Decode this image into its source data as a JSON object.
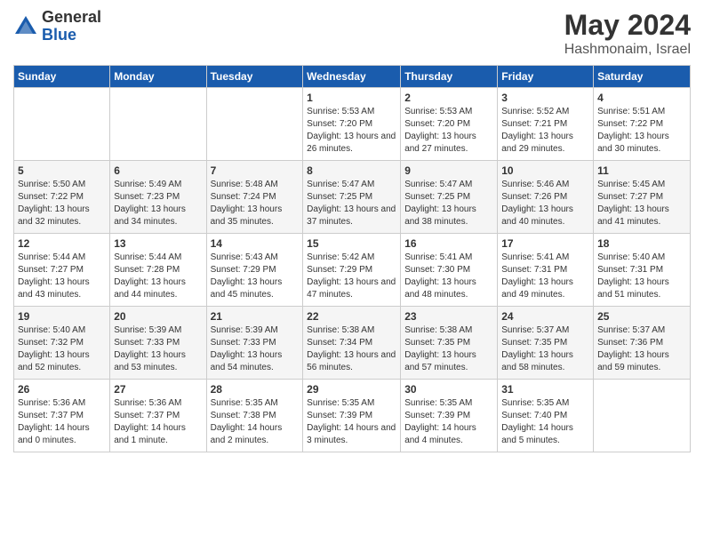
{
  "logo": {
    "general": "General",
    "blue": "Blue"
  },
  "title": "May 2024",
  "location": "Hashmonaim, Israel",
  "headers": [
    "Sunday",
    "Monday",
    "Tuesday",
    "Wednesday",
    "Thursday",
    "Friday",
    "Saturday"
  ],
  "weeks": [
    [
      {
        "day": "",
        "sunrise": "",
        "sunset": "",
        "daylight": ""
      },
      {
        "day": "",
        "sunrise": "",
        "sunset": "",
        "daylight": ""
      },
      {
        "day": "",
        "sunrise": "",
        "sunset": "",
        "daylight": ""
      },
      {
        "day": "1",
        "sunrise": "Sunrise: 5:53 AM",
        "sunset": "Sunset: 7:20 PM",
        "daylight": "Daylight: 13 hours and 26 minutes."
      },
      {
        "day": "2",
        "sunrise": "Sunrise: 5:53 AM",
        "sunset": "Sunset: 7:20 PM",
        "daylight": "Daylight: 13 hours and 27 minutes."
      },
      {
        "day": "3",
        "sunrise": "Sunrise: 5:52 AM",
        "sunset": "Sunset: 7:21 PM",
        "daylight": "Daylight: 13 hours and 29 minutes."
      },
      {
        "day": "4",
        "sunrise": "Sunrise: 5:51 AM",
        "sunset": "Sunset: 7:22 PM",
        "daylight": "Daylight: 13 hours and 30 minutes."
      }
    ],
    [
      {
        "day": "5",
        "sunrise": "Sunrise: 5:50 AM",
        "sunset": "Sunset: 7:22 PM",
        "daylight": "Daylight: 13 hours and 32 minutes."
      },
      {
        "day": "6",
        "sunrise": "Sunrise: 5:49 AM",
        "sunset": "Sunset: 7:23 PM",
        "daylight": "Daylight: 13 hours and 34 minutes."
      },
      {
        "day": "7",
        "sunrise": "Sunrise: 5:48 AM",
        "sunset": "Sunset: 7:24 PM",
        "daylight": "Daylight: 13 hours and 35 minutes."
      },
      {
        "day": "8",
        "sunrise": "Sunrise: 5:47 AM",
        "sunset": "Sunset: 7:25 PM",
        "daylight": "Daylight: 13 hours and 37 minutes."
      },
      {
        "day": "9",
        "sunrise": "Sunrise: 5:47 AM",
        "sunset": "Sunset: 7:25 PM",
        "daylight": "Daylight: 13 hours and 38 minutes."
      },
      {
        "day": "10",
        "sunrise": "Sunrise: 5:46 AM",
        "sunset": "Sunset: 7:26 PM",
        "daylight": "Daylight: 13 hours and 40 minutes."
      },
      {
        "day": "11",
        "sunrise": "Sunrise: 5:45 AM",
        "sunset": "Sunset: 7:27 PM",
        "daylight": "Daylight: 13 hours and 41 minutes."
      }
    ],
    [
      {
        "day": "12",
        "sunrise": "Sunrise: 5:44 AM",
        "sunset": "Sunset: 7:27 PM",
        "daylight": "Daylight: 13 hours and 43 minutes."
      },
      {
        "day": "13",
        "sunrise": "Sunrise: 5:44 AM",
        "sunset": "Sunset: 7:28 PM",
        "daylight": "Daylight: 13 hours and 44 minutes."
      },
      {
        "day": "14",
        "sunrise": "Sunrise: 5:43 AM",
        "sunset": "Sunset: 7:29 PM",
        "daylight": "Daylight: 13 hours and 45 minutes."
      },
      {
        "day": "15",
        "sunrise": "Sunrise: 5:42 AM",
        "sunset": "Sunset: 7:29 PM",
        "daylight": "Daylight: 13 hours and 47 minutes."
      },
      {
        "day": "16",
        "sunrise": "Sunrise: 5:41 AM",
        "sunset": "Sunset: 7:30 PM",
        "daylight": "Daylight: 13 hours and 48 minutes."
      },
      {
        "day": "17",
        "sunrise": "Sunrise: 5:41 AM",
        "sunset": "Sunset: 7:31 PM",
        "daylight": "Daylight: 13 hours and 49 minutes."
      },
      {
        "day": "18",
        "sunrise": "Sunrise: 5:40 AM",
        "sunset": "Sunset: 7:31 PM",
        "daylight": "Daylight: 13 hours and 51 minutes."
      }
    ],
    [
      {
        "day": "19",
        "sunrise": "Sunrise: 5:40 AM",
        "sunset": "Sunset: 7:32 PM",
        "daylight": "Daylight: 13 hours and 52 minutes."
      },
      {
        "day": "20",
        "sunrise": "Sunrise: 5:39 AM",
        "sunset": "Sunset: 7:33 PM",
        "daylight": "Daylight: 13 hours and 53 minutes."
      },
      {
        "day": "21",
        "sunrise": "Sunrise: 5:39 AM",
        "sunset": "Sunset: 7:33 PM",
        "daylight": "Daylight: 13 hours and 54 minutes."
      },
      {
        "day": "22",
        "sunrise": "Sunrise: 5:38 AM",
        "sunset": "Sunset: 7:34 PM",
        "daylight": "Daylight: 13 hours and 56 minutes."
      },
      {
        "day": "23",
        "sunrise": "Sunrise: 5:38 AM",
        "sunset": "Sunset: 7:35 PM",
        "daylight": "Daylight: 13 hours and 57 minutes."
      },
      {
        "day": "24",
        "sunrise": "Sunrise: 5:37 AM",
        "sunset": "Sunset: 7:35 PM",
        "daylight": "Daylight: 13 hours and 58 minutes."
      },
      {
        "day": "25",
        "sunrise": "Sunrise: 5:37 AM",
        "sunset": "Sunset: 7:36 PM",
        "daylight": "Daylight: 13 hours and 59 minutes."
      }
    ],
    [
      {
        "day": "26",
        "sunrise": "Sunrise: 5:36 AM",
        "sunset": "Sunset: 7:37 PM",
        "daylight": "Daylight: 14 hours and 0 minutes."
      },
      {
        "day": "27",
        "sunrise": "Sunrise: 5:36 AM",
        "sunset": "Sunset: 7:37 PM",
        "daylight": "Daylight: 14 hours and 1 minute."
      },
      {
        "day": "28",
        "sunrise": "Sunrise: 5:35 AM",
        "sunset": "Sunset: 7:38 PM",
        "daylight": "Daylight: 14 hours and 2 minutes."
      },
      {
        "day": "29",
        "sunrise": "Sunrise: 5:35 AM",
        "sunset": "Sunset: 7:39 PM",
        "daylight": "Daylight: 14 hours and 3 minutes."
      },
      {
        "day": "30",
        "sunrise": "Sunrise: 5:35 AM",
        "sunset": "Sunset: 7:39 PM",
        "daylight": "Daylight: 14 hours and 4 minutes."
      },
      {
        "day": "31",
        "sunrise": "Sunrise: 5:35 AM",
        "sunset": "Sunset: 7:40 PM",
        "daylight": "Daylight: 14 hours and 5 minutes."
      },
      {
        "day": "",
        "sunrise": "",
        "sunset": "",
        "daylight": ""
      }
    ]
  ]
}
